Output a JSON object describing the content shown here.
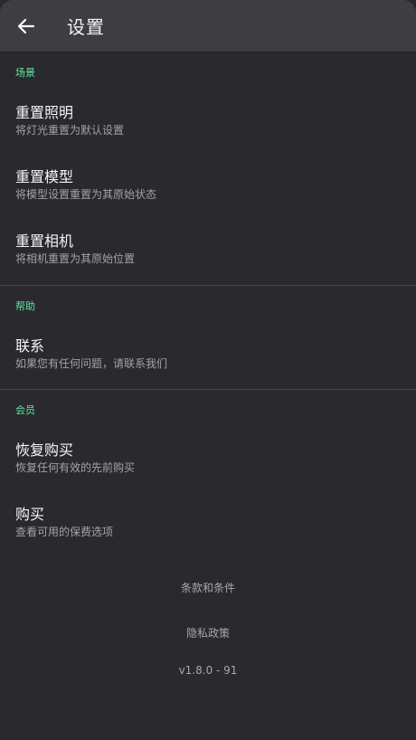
{
  "appbar": {
    "title": "设置",
    "back_icon": "arrow-left-icon"
  },
  "sections": [
    {
      "header": "场景",
      "items": [
        {
          "title": "重置照明",
          "subtitle": "将灯光重置为默认设置"
        },
        {
          "title": "重置模型",
          "subtitle": "将模型设置重置为其原始状态"
        },
        {
          "title": "重置相机",
          "subtitle": "将相机重置为其原始位置"
        }
      ]
    },
    {
      "header": "帮助",
      "items": [
        {
          "title": "联系",
          "subtitle": "如果您有任何问题，请联系我们"
        }
      ]
    },
    {
      "header": "会员",
      "items": [
        {
          "title": "恢复购买",
          "subtitle": "恢复任何有效的先前购买"
        },
        {
          "title": "购买",
          "subtitle": "查看可用的保费选项"
        }
      ]
    }
  ],
  "footer": {
    "terms": "条款和条件",
    "privacy": "隐私政策",
    "version": "v1.8.0 - 91"
  },
  "colors": {
    "accent": "#5fe6a0",
    "background": "#2a292e",
    "appbar": "#3e3d42"
  }
}
